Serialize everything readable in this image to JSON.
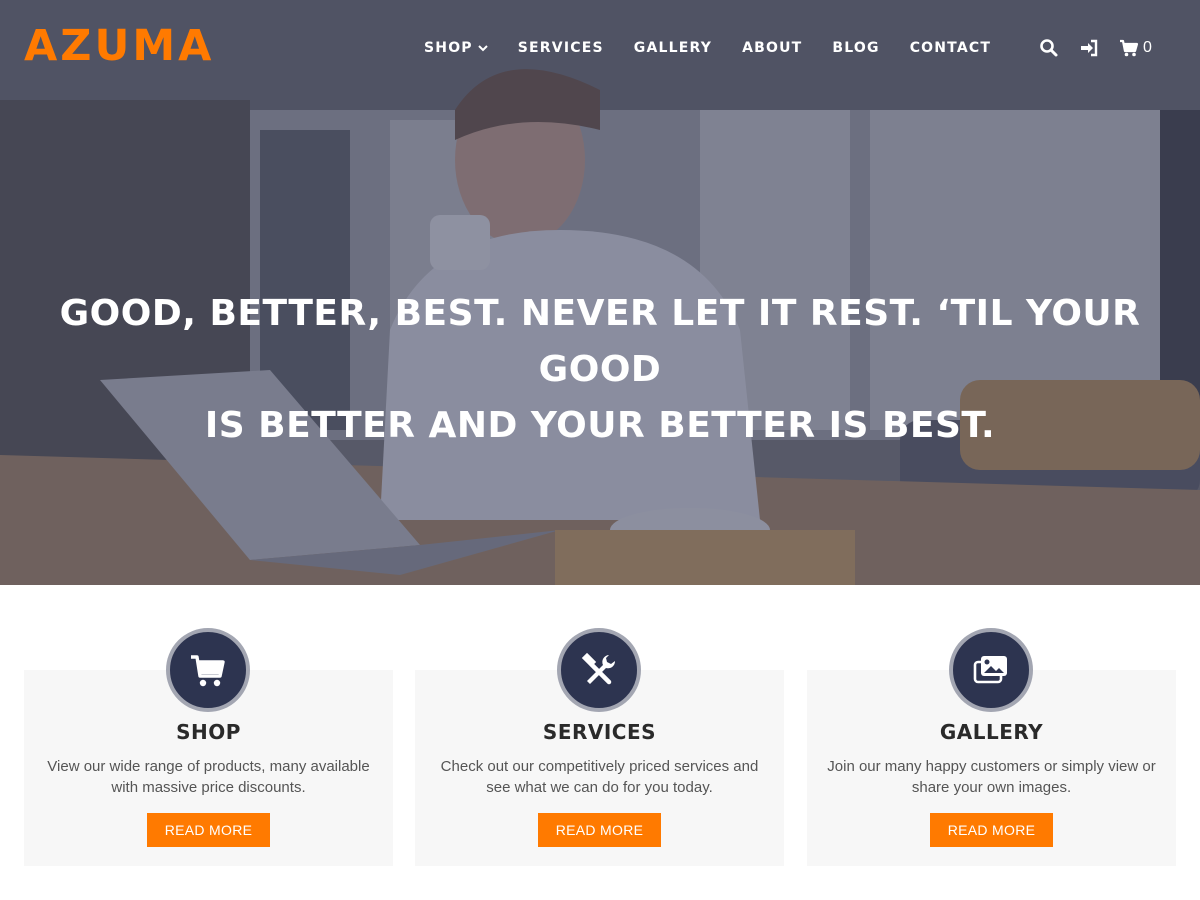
{
  "brand": {
    "logo_text": "AZUMA",
    "accent_color": "#ff7a00"
  },
  "nav": {
    "items": [
      {
        "label": "SHOP",
        "has_dropdown": true
      },
      {
        "label": "SERVICES"
      },
      {
        "label": "GALLERY"
      },
      {
        "label": "ABOUT"
      },
      {
        "label": "BLOG"
      },
      {
        "label": "CONTACT"
      }
    ]
  },
  "header_icons": {
    "search": "search-icon",
    "login": "sign-in-icon",
    "cart": "cart-icon",
    "cart_count": "0"
  },
  "hero": {
    "headline_line1": "GOOD, BETTER, BEST. NEVER LET IT REST. ‘TIL YOUR GOOD",
    "headline_line2": "IS BETTER AND YOUR BETTER IS BEST."
  },
  "features": [
    {
      "icon": "shopping-cart-icon",
      "title": "SHOP",
      "text": "View our wide range of products, many available with massive price discounts.",
      "button": "READ MORE"
    },
    {
      "icon": "tools-icon",
      "title": "SERVICES",
      "text": "Check out our competitively priced services and see what we can do for you today.",
      "button": "READ MORE"
    },
    {
      "icon": "images-icon",
      "title": "GALLERY",
      "text": "Join our many happy customers or simply view or share your own images.",
      "button": "READ MORE"
    }
  ],
  "colors": {
    "badge_bg": "#2d3450",
    "badge_ring": "#a3a6b2",
    "card_bg": "#f7f7f7"
  }
}
